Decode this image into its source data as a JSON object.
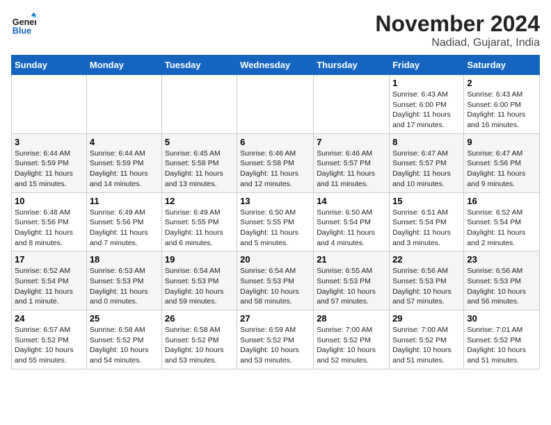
{
  "header": {
    "logo_general": "General",
    "logo_blue": "Blue",
    "month_title": "November 2024",
    "location": "Nadiad, Gujarat, India"
  },
  "weekdays": [
    "Sunday",
    "Monday",
    "Tuesday",
    "Wednesday",
    "Thursday",
    "Friday",
    "Saturday"
  ],
  "weeks": [
    [
      {
        "day": "",
        "details": ""
      },
      {
        "day": "",
        "details": ""
      },
      {
        "day": "",
        "details": ""
      },
      {
        "day": "",
        "details": ""
      },
      {
        "day": "",
        "details": ""
      },
      {
        "day": "1",
        "details": "Sunrise: 6:43 AM\nSunset: 6:00 PM\nDaylight: 11 hours and 17 minutes."
      },
      {
        "day": "2",
        "details": "Sunrise: 6:43 AM\nSunset: 6:00 PM\nDaylight: 11 hours and 16 minutes."
      }
    ],
    [
      {
        "day": "3",
        "details": "Sunrise: 6:44 AM\nSunset: 5:59 PM\nDaylight: 11 hours and 15 minutes."
      },
      {
        "day": "4",
        "details": "Sunrise: 6:44 AM\nSunset: 5:59 PM\nDaylight: 11 hours and 14 minutes."
      },
      {
        "day": "5",
        "details": "Sunrise: 6:45 AM\nSunset: 5:58 PM\nDaylight: 11 hours and 13 minutes."
      },
      {
        "day": "6",
        "details": "Sunrise: 6:46 AM\nSunset: 5:58 PM\nDaylight: 11 hours and 12 minutes."
      },
      {
        "day": "7",
        "details": "Sunrise: 6:46 AM\nSunset: 5:57 PM\nDaylight: 11 hours and 11 minutes."
      },
      {
        "day": "8",
        "details": "Sunrise: 6:47 AM\nSunset: 5:57 PM\nDaylight: 11 hours and 10 minutes."
      },
      {
        "day": "9",
        "details": "Sunrise: 6:47 AM\nSunset: 5:56 PM\nDaylight: 11 hours and 9 minutes."
      }
    ],
    [
      {
        "day": "10",
        "details": "Sunrise: 6:48 AM\nSunset: 5:56 PM\nDaylight: 11 hours and 8 minutes."
      },
      {
        "day": "11",
        "details": "Sunrise: 6:49 AM\nSunset: 5:56 PM\nDaylight: 11 hours and 7 minutes."
      },
      {
        "day": "12",
        "details": "Sunrise: 6:49 AM\nSunset: 5:55 PM\nDaylight: 11 hours and 6 minutes."
      },
      {
        "day": "13",
        "details": "Sunrise: 6:50 AM\nSunset: 5:55 PM\nDaylight: 11 hours and 5 minutes."
      },
      {
        "day": "14",
        "details": "Sunrise: 6:50 AM\nSunset: 5:54 PM\nDaylight: 11 hours and 4 minutes."
      },
      {
        "day": "15",
        "details": "Sunrise: 6:51 AM\nSunset: 5:54 PM\nDaylight: 11 hours and 3 minutes."
      },
      {
        "day": "16",
        "details": "Sunrise: 6:52 AM\nSunset: 5:54 PM\nDaylight: 11 hours and 2 minutes."
      }
    ],
    [
      {
        "day": "17",
        "details": "Sunrise: 6:52 AM\nSunset: 5:54 PM\nDaylight: 11 hours and 1 minute."
      },
      {
        "day": "18",
        "details": "Sunrise: 6:53 AM\nSunset: 5:53 PM\nDaylight: 11 hours and 0 minutes."
      },
      {
        "day": "19",
        "details": "Sunrise: 6:54 AM\nSunset: 5:53 PM\nDaylight: 10 hours and 59 minutes."
      },
      {
        "day": "20",
        "details": "Sunrise: 6:54 AM\nSunset: 5:53 PM\nDaylight: 10 hours and 58 minutes."
      },
      {
        "day": "21",
        "details": "Sunrise: 6:55 AM\nSunset: 5:53 PM\nDaylight: 10 hours and 57 minutes."
      },
      {
        "day": "22",
        "details": "Sunrise: 6:56 AM\nSunset: 5:53 PM\nDaylight: 10 hours and 57 minutes."
      },
      {
        "day": "23",
        "details": "Sunrise: 6:56 AM\nSunset: 5:53 PM\nDaylight: 10 hours and 56 minutes."
      }
    ],
    [
      {
        "day": "24",
        "details": "Sunrise: 6:57 AM\nSunset: 5:52 PM\nDaylight: 10 hours and 55 minutes."
      },
      {
        "day": "25",
        "details": "Sunrise: 6:58 AM\nSunset: 5:52 PM\nDaylight: 10 hours and 54 minutes."
      },
      {
        "day": "26",
        "details": "Sunrise: 6:58 AM\nSunset: 5:52 PM\nDaylight: 10 hours and 53 minutes."
      },
      {
        "day": "27",
        "details": "Sunrise: 6:59 AM\nSunset: 5:52 PM\nDaylight: 10 hours and 53 minutes."
      },
      {
        "day": "28",
        "details": "Sunrise: 7:00 AM\nSunset: 5:52 PM\nDaylight: 10 hours and 52 minutes."
      },
      {
        "day": "29",
        "details": "Sunrise: 7:00 AM\nSunset: 5:52 PM\nDaylight: 10 hours and 51 minutes."
      },
      {
        "day": "30",
        "details": "Sunrise: 7:01 AM\nSunset: 5:52 PM\nDaylight: 10 hours and 51 minutes."
      }
    ]
  ]
}
